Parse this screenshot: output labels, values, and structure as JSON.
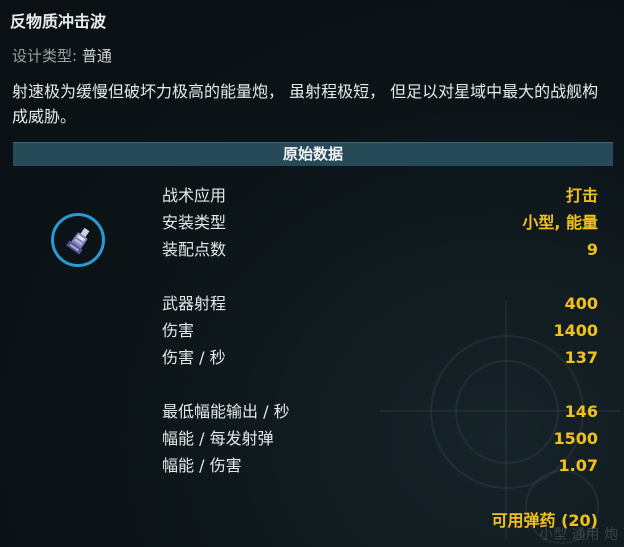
{
  "weapon": {
    "name": "反物质冲击波",
    "design_type_label": "设计类型:",
    "design_type_value": "普通",
    "description": "射速极为缓慢但破坏力极高的能量炮， 虽射程极短， 但足以对星域中最大的战舰构成威胁。",
    "icon": "weapon-turret-icon"
  },
  "section": {
    "header": "原始数据"
  },
  "stats": [
    {
      "label": "战术应用",
      "value": "打击"
    },
    {
      "label": "安装类型",
      "value": "小型, 能量"
    },
    {
      "label": "装配点数",
      "value": "9"
    },
    {
      "label": "武器射程",
      "value": "400"
    },
    {
      "label": "伤害",
      "value": "1400"
    },
    {
      "label": "伤害 / 秒",
      "value": "137"
    },
    {
      "label": "最低幅能输出 / 秒",
      "value": "146"
    },
    {
      "label": "幅能 / 每发射弹",
      "value": "1500"
    },
    {
      "label": "幅能 / 伤害",
      "value": "1.07"
    }
  ],
  "ammo": "可用弹药 (20)",
  "background_hint": "小型 通用 炮",
  "colors": {
    "accent_value": "#f2c21b",
    "header_bar": "#264a57",
    "icon_ring": "#2a9ad6",
    "background": "#0b1114"
  }
}
